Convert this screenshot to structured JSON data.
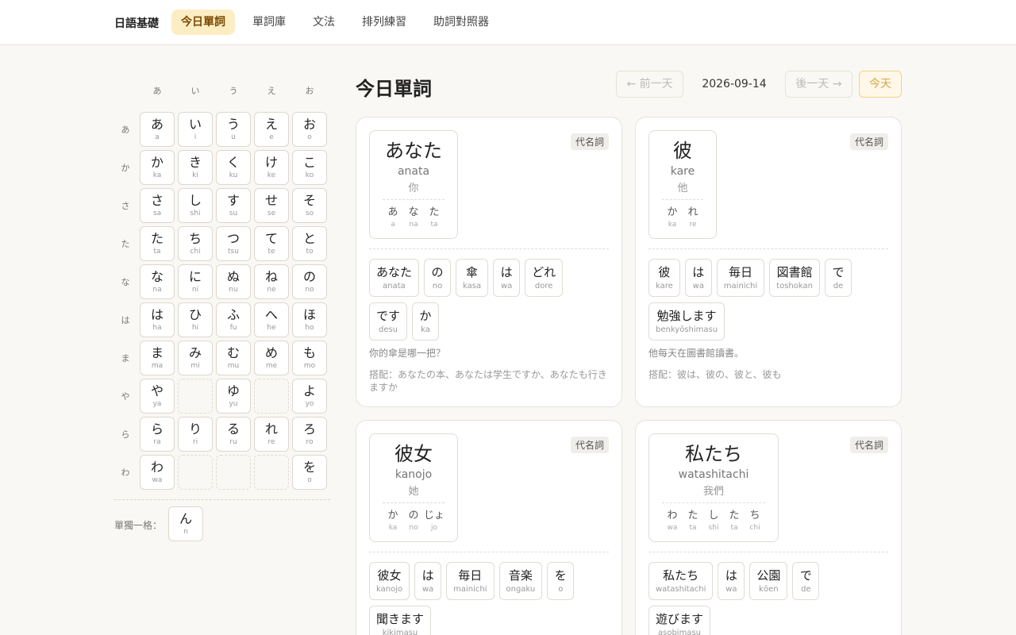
{
  "nav": {
    "brand": "日語基礎",
    "items": [
      {
        "label": "今日單詞",
        "active": true
      },
      {
        "label": "單詞庫",
        "active": false
      },
      {
        "label": "文法",
        "active": false
      },
      {
        "label": "排列練習",
        "active": false
      },
      {
        "label": "助詞對照器",
        "active": false
      }
    ]
  },
  "kana": {
    "columns": [
      "あ",
      "い",
      "う",
      "え",
      "お"
    ],
    "rows": [
      {
        "label": "あ",
        "cells": [
          {
            "k": "あ",
            "r": "a"
          },
          {
            "k": "い",
            "r": "i"
          },
          {
            "k": "う",
            "r": "u"
          },
          {
            "k": "え",
            "r": "e"
          },
          {
            "k": "お",
            "r": "o"
          }
        ]
      },
      {
        "label": "か",
        "cells": [
          {
            "k": "か",
            "r": "ka"
          },
          {
            "k": "き",
            "r": "ki"
          },
          {
            "k": "く",
            "r": "ku"
          },
          {
            "k": "け",
            "r": "ke"
          },
          {
            "k": "こ",
            "r": "ko"
          }
        ]
      },
      {
        "label": "さ",
        "cells": [
          {
            "k": "さ",
            "r": "sa"
          },
          {
            "k": "し",
            "r": "shi"
          },
          {
            "k": "す",
            "r": "su"
          },
          {
            "k": "せ",
            "r": "se"
          },
          {
            "k": "そ",
            "r": "so"
          }
        ]
      },
      {
        "label": "た",
        "cells": [
          {
            "k": "た",
            "r": "ta"
          },
          {
            "k": "ち",
            "r": "chi"
          },
          {
            "k": "つ",
            "r": "tsu"
          },
          {
            "k": "て",
            "r": "te"
          },
          {
            "k": "と",
            "r": "to"
          }
        ]
      },
      {
        "label": "な",
        "cells": [
          {
            "k": "な",
            "r": "na"
          },
          {
            "k": "に",
            "r": "ni"
          },
          {
            "k": "ぬ",
            "r": "nu"
          },
          {
            "k": "ね",
            "r": "ne"
          },
          {
            "k": "の",
            "r": "no"
          }
        ]
      },
      {
        "label": "は",
        "cells": [
          {
            "k": "は",
            "r": "ha"
          },
          {
            "k": "ひ",
            "r": "hi"
          },
          {
            "k": "ふ",
            "r": "fu"
          },
          {
            "k": "へ",
            "r": "he"
          },
          {
            "k": "ほ",
            "r": "ho"
          }
        ]
      },
      {
        "label": "ま",
        "cells": [
          {
            "k": "ま",
            "r": "ma"
          },
          {
            "k": "み",
            "r": "mi"
          },
          {
            "k": "む",
            "r": "mu"
          },
          {
            "k": "め",
            "r": "me"
          },
          {
            "k": "も",
            "r": "mo"
          }
        ]
      },
      {
        "label": "や",
        "cells": [
          {
            "k": "や",
            "r": "ya"
          },
          null,
          {
            "k": "ゆ",
            "r": "yu"
          },
          null,
          {
            "k": "よ",
            "r": "yo"
          }
        ]
      },
      {
        "label": "ら",
        "cells": [
          {
            "k": "ら",
            "r": "ra"
          },
          {
            "k": "り",
            "r": "ri"
          },
          {
            "k": "る",
            "r": "ru"
          },
          {
            "k": "れ",
            "r": "re"
          },
          {
            "k": "ろ",
            "r": "ro"
          }
        ]
      },
      {
        "label": "わ",
        "cells": [
          {
            "k": "わ",
            "r": "wa"
          },
          null,
          null,
          null,
          {
            "k": "を",
            "r": "o"
          }
        ]
      }
    ],
    "single_label": "單獨一格：",
    "single": {
      "k": "ん",
      "r": "n"
    }
  },
  "main": {
    "title": "今日單詞",
    "prev_label": "← 前一天",
    "date": "2026-09-14",
    "next_label": "後一天 →",
    "today_label": "今天"
  },
  "cards": [
    {
      "word": "あなた",
      "romaji": "anata",
      "meaning": "你",
      "pos": "代名詞",
      "syllables": [
        {
          "k": "あ",
          "r": "a"
        },
        {
          "k": "な",
          "r": "na"
        },
        {
          "k": "た",
          "r": "ta"
        }
      ],
      "chips": [
        {
          "k": "あなた",
          "r": "anata"
        },
        {
          "k": "の",
          "r": "no"
        },
        {
          "k": "傘",
          "r": "kasa"
        },
        {
          "k": "は",
          "r": "wa"
        },
        {
          "k": "どれ",
          "r": "dore"
        },
        {
          "k": "です",
          "r": "desu"
        },
        {
          "k": "か",
          "r": "ka"
        }
      ],
      "sentence": "你的傘是哪一把？",
      "collocation": "搭配：あなたの本、あなたは学生ですか、あなたも行きますか"
    },
    {
      "word": "彼",
      "romaji": "kare",
      "meaning": "他",
      "pos": "代名詞",
      "syllables": [
        {
          "k": "か",
          "r": "ka"
        },
        {
          "k": "れ",
          "r": "re"
        }
      ],
      "chips": [
        {
          "k": "彼",
          "r": "kare"
        },
        {
          "k": "は",
          "r": "wa"
        },
        {
          "k": "毎日",
          "r": "mainichi"
        },
        {
          "k": "図書館",
          "r": "toshokan"
        },
        {
          "k": "で",
          "r": "de"
        },
        {
          "k": "勉強します",
          "r": "benkyōshimasu"
        }
      ],
      "sentence": "他每天在圖書館讀書。",
      "collocation": "搭配：彼は、彼の、彼と、彼も"
    },
    {
      "word": "彼女",
      "romaji": "kanojo",
      "meaning": "她",
      "pos": "代名詞",
      "syllables": [
        {
          "k": "か",
          "r": "ka"
        },
        {
          "k": "の",
          "r": "no"
        },
        {
          "k": "じょ",
          "r": "jo"
        }
      ],
      "chips": [
        {
          "k": "彼女",
          "r": "kanojo"
        },
        {
          "k": "は",
          "r": "wa"
        },
        {
          "k": "毎日",
          "r": "mainichi"
        },
        {
          "k": "音楽",
          "r": "ongaku"
        },
        {
          "k": "を",
          "r": "o"
        },
        {
          "k": "聞きます",
          "r": "kikimasu"
        }
      ],
      "sentence": "",
      "collocation": ""
    },
    {
      "word": "私たち",
      "romaji": "watashitachi",
      "meaning": "我們",
      "pos": "代名詞",
      "syllables": [
        {
          "k": "わ",
          "r": "wa"
        },
        {
          "k": "た",
          "r": "ta"
        },
        {
          "k": "し",
          "r": "shi"
        },
        {
          "k": "た",
          "r": "ta"
        },
        {
          "k": "ち",
          "r": "chi"
        }
      ],
      "chips": [
        {
          "k": "私たち",
          "r": "watashitachi"
        },
        {
          "k": "は",
          "r": "wa"
        },
        {
          "k": "公園",
          "r": "kōen"
        },
        {
          "k": "で",
          "r": "de"
        },
        {
          "k": "遊びます",
          "r": "asobimasu"
        }
      ],
      "sentence": "",
      "collocation": ""
    }
  ]
}
